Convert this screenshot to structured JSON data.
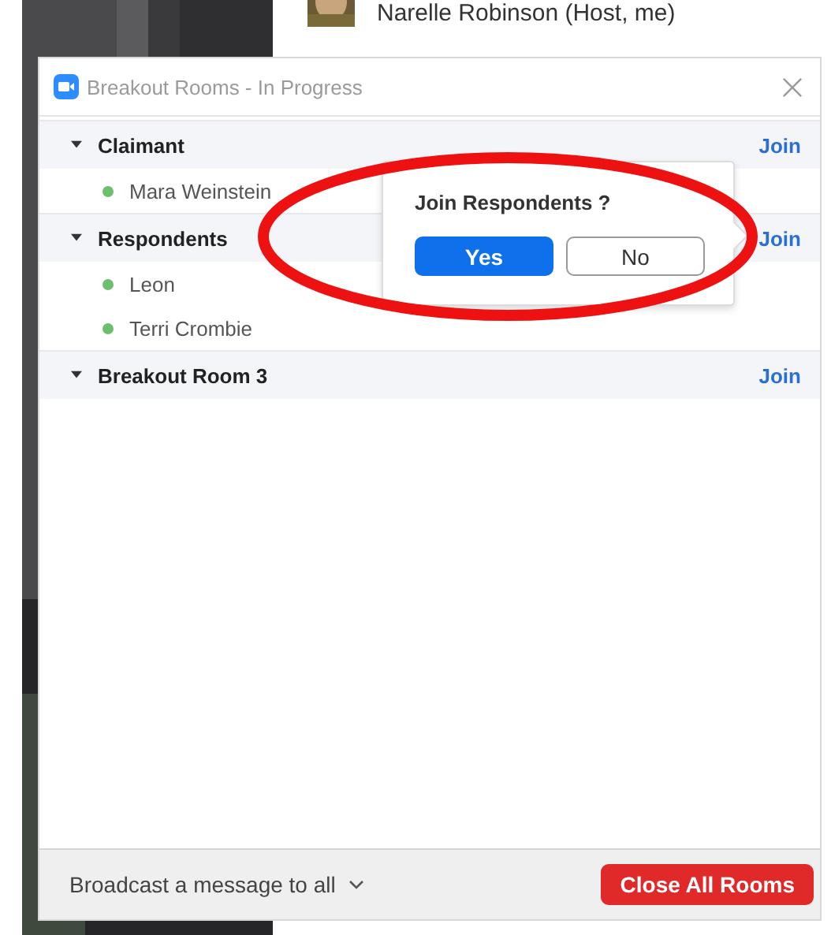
{
  "background": {
    "participant": {
      "name": "Narelle Robinson (Host, me)"
    }
  },
  "window": {
    "title": "Breakout Rooms - In Progress"
  },
  "rooms": [
    {
      "name": "Claimant",
      "expanded": true,
      "join": "Join",
      "participants": [
        {
          "name": "Mara Weinstein"
        }
      ]
    },
    {
      "name": "Respondents",
      "expanded": true,
      "join": "Join",
      "participants": [
        {
          "name": "Leon"
        },
        {
          "name": "Terri Crombie"
        }
      ]
    },
    {
      "name": "Breakout Room 3",
      "expanded": true,
      "join": "Join"
    }
  ],
  "popup": {
    "question": "Join Respondents ?",
    "buttons": [
      {
        "label": "Yes",
        "kind": "primary"
      },
      {
        "label": "No",
        "kind": "secondary"
      }
    ]
  },
  "footer": {
    "broadcast": "Broadcast a message to all",
    "close_button": "Close All Rooms"
  }
}
